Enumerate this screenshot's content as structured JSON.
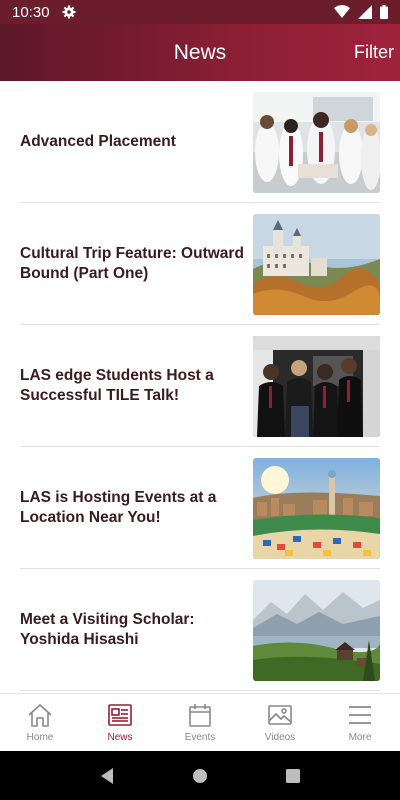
{
  "status_bar": {
    "time": "10:30"
  },
  "header": {
    "title": "News",
    "filter_label": "Filter"
  },
  "news": [
    {
      "headline": "Advanced Placement",
      "image": "students-in-lab-coats"
    },
    {
      "headline": "Cultural Trip Feature: Outward Bound (Part One)",
      "image": "castle-in-autumn-forest"
    },
    {
      "headline": "LAS edge Students Host a Successful TILE Talk!",
      "image": "students-group-photo"
    },
    {
      "headline": "LAS is Hosting Events at a Location Near You!",
      "image": "mosaic-park-city-view"
    },
    {
      "headline": "Meet a Visiting Scholar: Yoshida Hisashi",
      "image": "alpine-lake-mountains"
    }
  ],
  "bottom_nav": [
    {
      "label": "Home",
      "icon": "home-icon",
      "active": false
    },
    {
      "label": "News",
      "icon": "news-icon",
      "active": true
    },
    {
      "label": "Events",
      "icon": "calendar-icon",
      "active": false
    },
    {
      "label": "Videos",
      "icon": "image-icon",
      "active": false
    },
    {
      "label": "More",
      "icon": "menu-icon",
      "active": false
    }
  ],
  "colors": {
    "brand": "#8b1f35",
    "active_tab": "#9b1b34",
    "headline": "#3a1a20"
  }
}
